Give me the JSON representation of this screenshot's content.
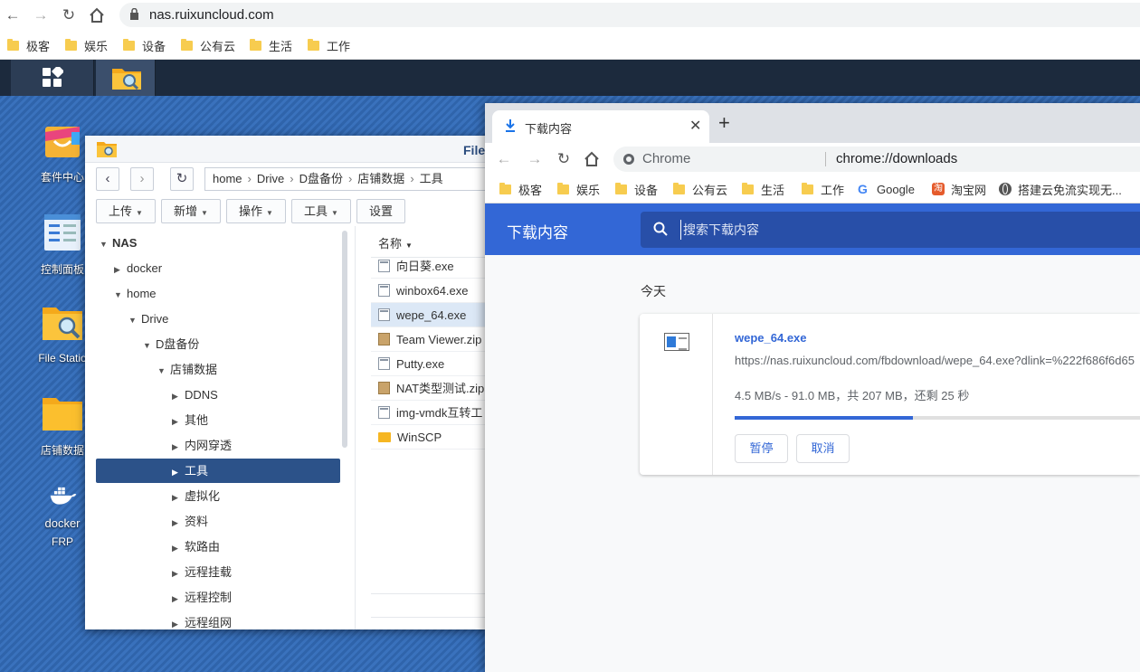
{
  "outer_browser": {
    "url": "nas.ruixuncloud.com",
    "bookmarks": [
      "极客",
      "娱乐",
      "设备",
      "公有云",
      "生活",
      "工作"
    ]
  },
  "desktop": {
    "icons": [
      {
        "label": "套件中心"
      },
      {
        "label": "控制面板"
      },
      {
        "label": "File Statio"
      },
      {
        "label": "店铺数据"
      },
      {
        "label": "FRP",
        "logo_text": "docker"
      }
    ]
  },
  "file_station": {
    "title": "File",
    "path": [
      "home",
      "Drive",
      "D盘备份",
      "店铺数据",
      "工具"
    ],
    "toolbar": {
      "upload": "上传",
      "new": "新增",
      "action": "操作",
      "tools": "工具",
      "settings": "设置"
    },
    "tree": [
      {
        "label": "NAS",
        "level": 0,
        "expanded": true
      },
      {
        "label": "docker",
        "level": 1,
        "expanded": false
      },
      {
        "label": "home",
        "level": 1,
        "expanded": true
      },
      {
        "label": "Drive",
        "level": 2,
        "expanded": true
      },
      {
        "label": "D盘备份",
        "level": 3,
        "expanded": true
      },
      {
        "label": "店铺数据",
        "level": 4,
        "expanded": true
      },
      {
        "label": "DDNS",
        "level": 5,
        "expanded": false
      },
      {
        "label": "其他",
        "level": 5,
        "expanded": false
      },
      {
        "label": "内网穿透",
        "level": 5,
        "expanded": false
      },
      {
        "label": "工具",
        "level": 5,
        "expanded": false,
        "selected": true
      },
      {
        "label": "虚拟化",
        "level": 5,
        "expanded": false
      },
      {
        "label": "资料",
        "level": 5,
        "expanded": false
      },
      {
        "label": "软路由",
        "level": 5,
        "expanded": false
      },
      {
        "label": "远程挂载",
        "level": 5,
        "expanded": false
      },
      {
        "label": "远程控制",
        "level": 5,
        "expanded": false
      },
      {
        "label": "远程组网",
        "level": 5,
        "expanded": false
      }
    ],
    "list_header": "名称",
    "files": [
      {
        "name": "向日葵.exe",
        "type": "file"
      },
      {
        "name": "winbox64.exe",
        "type": "file"
      },
      {
        "name": "wepe_64.exe",
        "type": "file",
        "selected": true
      },
      {
        "name": "Team Viewer.zip",
        "type": "zip"
      },
      {
        "name": "Putty.exe",
        "type": "file"
      },
      {
        "name": "NAT类型测试.zip",
        "type": "zip"
      },
      {
        "name": "img-vmdk互转工",
        "type": "file"
      },
      {
        "name": "WinSCP",
        "type": "folder"
      }
    ]
  },
  "chrome": {
    "tab_title": "下载内容",
    "omnibox_chip": "Chrome",
    "omnibox_url": "chrome://downloads",
    "bookmarks": [
      {
        "label": "极客",
        "icon": "folder"
      },
      {
        "label": "娱乐",
        "icon": "folder"
      },
      {
        "label": "设备",
        "icon": "folder"
      },
      {
        "label": "公有云",
        "icon": "folder"
      },
      {
        "label": "生活",
        "icon": "folder"
      },
      {
        "label": "工作",
        "icon": "folder"
      },
      {
        "label": "Google",
        "icon": "google"
      },
      {
        "label": "淘宝网",
        "icon": "taobao",
        "icon_text": "淘"
      },
      {
        "label": "搭建云免流实现无...",
        "icon": "globe"
      }
    ],
    "downloads_title": "下载内容",
    "search_placeholder": "搜索下载内容",
    "date_group": "今天",
    "download": {
      "filename": "wepe_64.exe",
      "url": "https://nas.ruixuncloud.com/fbdownload/wepe_64.exe?dlink=%222f686f6d65",
      "status": "4.5 MB/s - 91.0 MB，共 207 MB，还剩 25 秒",
      "progress_fraction": 0.4396,
      "pause": "暂停",
      "cancel": "取消"
    }
  },
  "colors": {
    "chrome_accent": "#3367d6",
    "dsm_selected": "#2c5289",
    "desktop_bg": "#3a6fb6"
  }
}
